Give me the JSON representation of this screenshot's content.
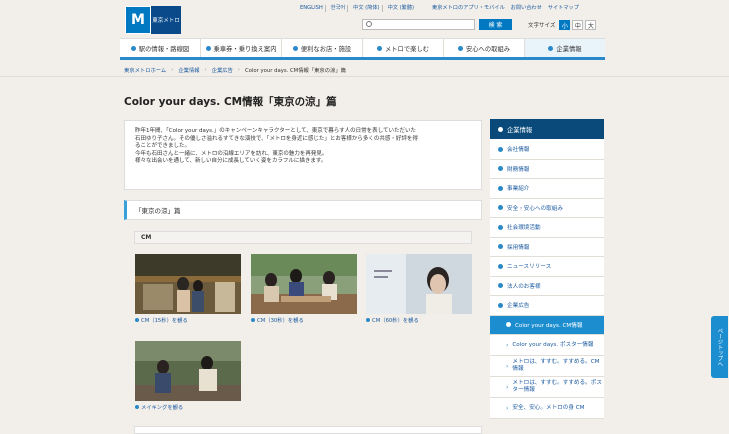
{
  "header": {
    "logo_text": "東京メトロ",
    "logo_mark": "M",
    "languages": [
      "ENGLISH",
      "한국어",
      "中文 (简体)",
      "中文 (繁體)"
    ],
    "top_links": [
      "東京メトロのアプリ・モバイル",
      "お問い合わせ",
      "サイトマップ"
    ],
    "search_placeholder": "",
    "search_button": "検 索",
    "font_size_label": "文字サイズ",
    "font_sizes": [
      "小",
      "中",
      "大"
    ]
  },
  "nav": {
    "items": [
      "駅の情報・路線図",
      "乗車券・乗り換え案内",
      "便利なお店・施設",
      "メトロで楽しむ",
      "安心への取組み",
      "企業情報"
    ]
  },
  "breadcrumb": [
    "東京メトロホーム",
    "企業情報",
    "企業広告",
    "Color your days. CM情報「東京の涼」篇"
  ],
  "page_title": "Color your days. CM情報「東京の涼」篇",
  "intro": {
    "lines": [
      "昨年1年間、「Color your days.」のキャンペーンキャラクターとして、東京で暮らす人の日常を表していただいた",
      "石田ゆり子さん。その優しさ溢れるすてきな演技で、「メトロを身近に感じた」とお客様から多くの共感・好評を得",
      "ることができました。",
      "今年も石田さんと一緒に、メトロの沿線エリアを訪れ、東京の魅力を再発見。",
      "様々な出会いを通して、新しい自分に成長していく姿をカラフルに描きます。"
    ]
  },
  "section_title": "「東京の涼」篇",
  "cm_label": "CM",
  "videos": [
    {
      "caption": "CM（15秒）を観る"
    },
    {
      "caption": "CM（30秒）を観る"
    },
    {
      "caption": "CM（60秒）を観る"
    },
    {
      "caption": "メイキングを観る"
    }
  ],
  "sidebar": {
    "head": "企業情報",
    "items": [
      "会社情報",
      "財務情報",
      "事業紹介",
      "安全・安心への取組み",
      "社会環境活動",
      "採用情報",
      "ニュースリリース",
      "法人のお客様",
      "企業広告"
    ],
    "active": "Color your days. CM情報",
    "sub_items": [
      "Color your days. ポスター情報",
      "メトロは、すすむ。すすめる。CM情報",
      "メトロは、すすむ。すすめる。ポスター情報",
      "安全、安心。メトロの身 CM"
    ]
  },
  "page_top": "ページトップへ"
}
